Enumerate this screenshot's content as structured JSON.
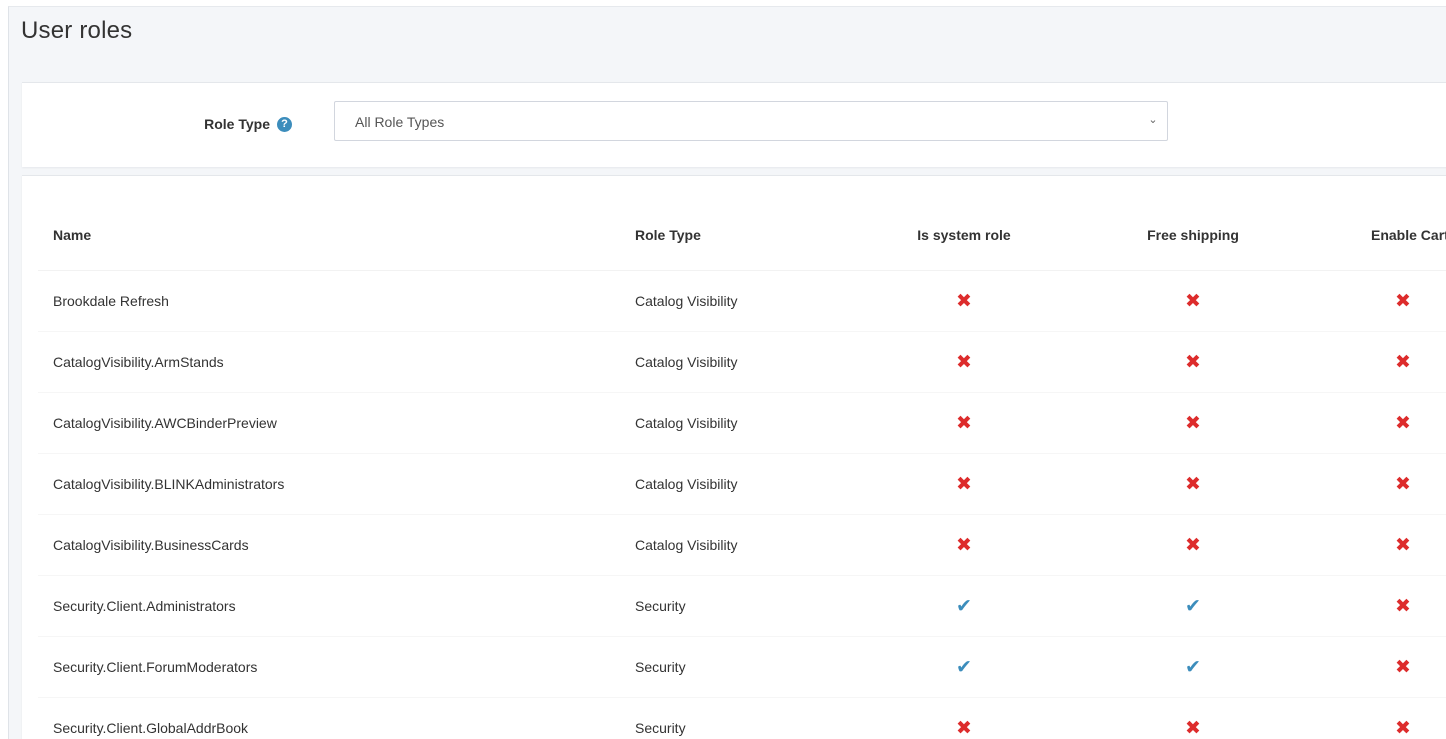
{
  "page": {
    "title": "User roles"
  },
  "filter": {
    "label": "Role Type",
    "help_icon": "question-circle-icon",
    "selected": "All Role Types"
  },
  "table": {
    "headers": {
      "name": "Name",
      "role_type": "Role Type",
      "is_system_role": "Is system role",
      "free_shipping": "Free shipping",
      "enable_cart": "Enable Cart"
    },
    "rows": [
      {
        "name": "Brookdale Refresh",
        "role_type": "Catalog Visibility",
        "is_system_role": false,
        "free_shipping": false,
        "enable_cart": false
      },
      {
        "name": "CatalogVisibility.ArmStands",
        "role_type": "Catalog Visibility",
        "is_system_role": false,
        "free_shipping": false,
        "enable_cart": false
      },
      {
        "name": "CatalogVisibility.AWCBinderPreview",
        "role_type": "Catalog Visibility",
        "is_system_role": false,
        "free_shipping": false,
        "enable_cart": false
      },
      {
        "name": "CatalogVisibility.BLINKAdministrators",
        "role_type": "Catalog Visibility",
        "is_system_role": false,
        "free_shipping": false,
        "enable_cart": false
      },
      {
        "name": "CatalogVisibility.BusinessCards",
        "role_type": "Catalog Visibility",
        "is_system_role": false,
        "free_shipping": false,
        "enable_cart": false
      },
      {
        "name": "Security.Client.Administrators",
        "role_type": "Security",
        "is_system_role": true,
        "free_shipping": true,
        "enable_cart": false
      },
      {
        "name": "Security.Client.ForumModerators",
        "role_type": "Security",
        "is_system_role": true,
        "free_shipping": true,
        "enable_cart": false
      },
      {
        "name": "Security.Client.GlobalAddrBook",
        "role_type": "Security",
        "is_system_role": false,
        "free_shipping": false,
        "enable_cart": false
      }
    ]
  },
  "colors": {
    "cross": "#dd2c2c",
    "check": "#3c8dbc",
    "help": "#3c8dbc"
  },
  "icons": {
    "true": "check-icon",
    "false": "cross-icon"
  }
}
